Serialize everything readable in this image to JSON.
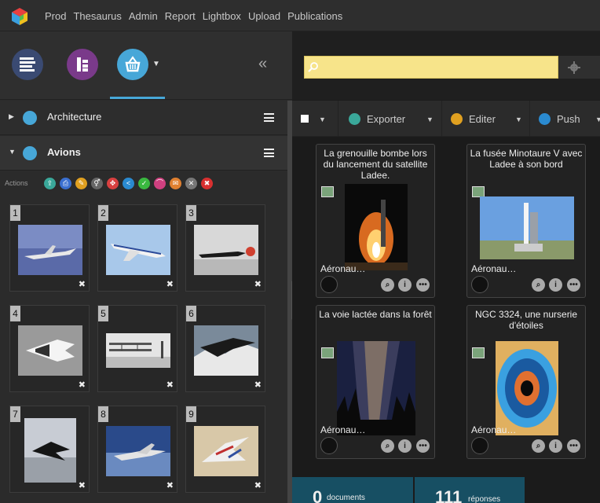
{
  "topnav": {
    "items": [
      "Prod",
      "Thesaurus",
      "Admin",
      "Report",
      "Lightbox",
      "Upload",
      "Publications"
    ]
  },
  "left": {
    "tabs": [
      "facets-icon",
      "thesaurus-icon",
      "basket-icon"
    ],
    "baskets": [
      {
        "title": "Architecture",
        "expanded": false
      },
      {
        "title": "Avions",
        "expanded": true
      }
    ],
    "actions_label": "Actions",
    "actions": [
      {
        "icon": "export-icon",
        "color": "#3aa89a"
      },
      {
        "icon": "print-icon",
        "color": "#3a6fd0"
      },
      {
        "icon": "edit-icon",
        "color": "#e0a020"
      },
      {
        "icon": "sex-icon",
        "color": "#666666"
      },
      {
        "icon": "move-icon",
        "color": "#d84040"
      },
      {
        "icon": "share-icon",
        "color": "#2a8ad0"
      },
      {
        "icon": "validate-icon",
        "color": "#3ab840"
      },
      {
        "icon": "bridge-icon",
        "color": "#d04080"
      },
      {
        "icon": "mail-icon",
        "color": "#e08030"
      },
      {
        "icon": "tools-icon",
        "color": "#777777"
      },
      {
        "icon": "delete-icon",
        "color": "#d83030"
      }
    ],
    "thumbs": [
      {
        "num": "1"
      },
      {
        "num": "2"
      },
      {
        "num": "3"
      },
      {
        "num": "4"
      },
      {
        "num": "5"
      },
      {
        "num": "6"
      },
      {
        "num": "7"
      },
      {
        "num": "8"
      },
      {
        "num": "9"
      }
    ]
  },
  "search": {
    "value": "",
    "placeholder": ""
  },
  "toolbar": {
    "export": "Exporter",
    "edit": "Editer",
    "push": "Push"
  },
  "cards": [
    {
      "title": "La grenouille bombe lors du lancement du satellite Ladee.",
      "owner": "Aéronau…"
    },
    {
      "title": "La fusée Minotaure V avec Ladee à son bord",
      "owner": "Aéronau…"
    },
    {
      "title": "La voie lactée dans la forêt",
      "owner": "Aéronau…"
    },
    {
      "title": "NGC 3324, une nurserie d'étoiles",
      "owner": "Aéronau…"
    }
  ],
  "stats": {
    "docs_count": "0",
    "docs_label": "documents",
    "answers_count": "111",
    "answers_label": "réponses"
  },
  "colors": {
    "accent": "#47a7d8",
    "search_bg": "#f7e48a",
    "stats_bg": "#174f63"
  }
}
